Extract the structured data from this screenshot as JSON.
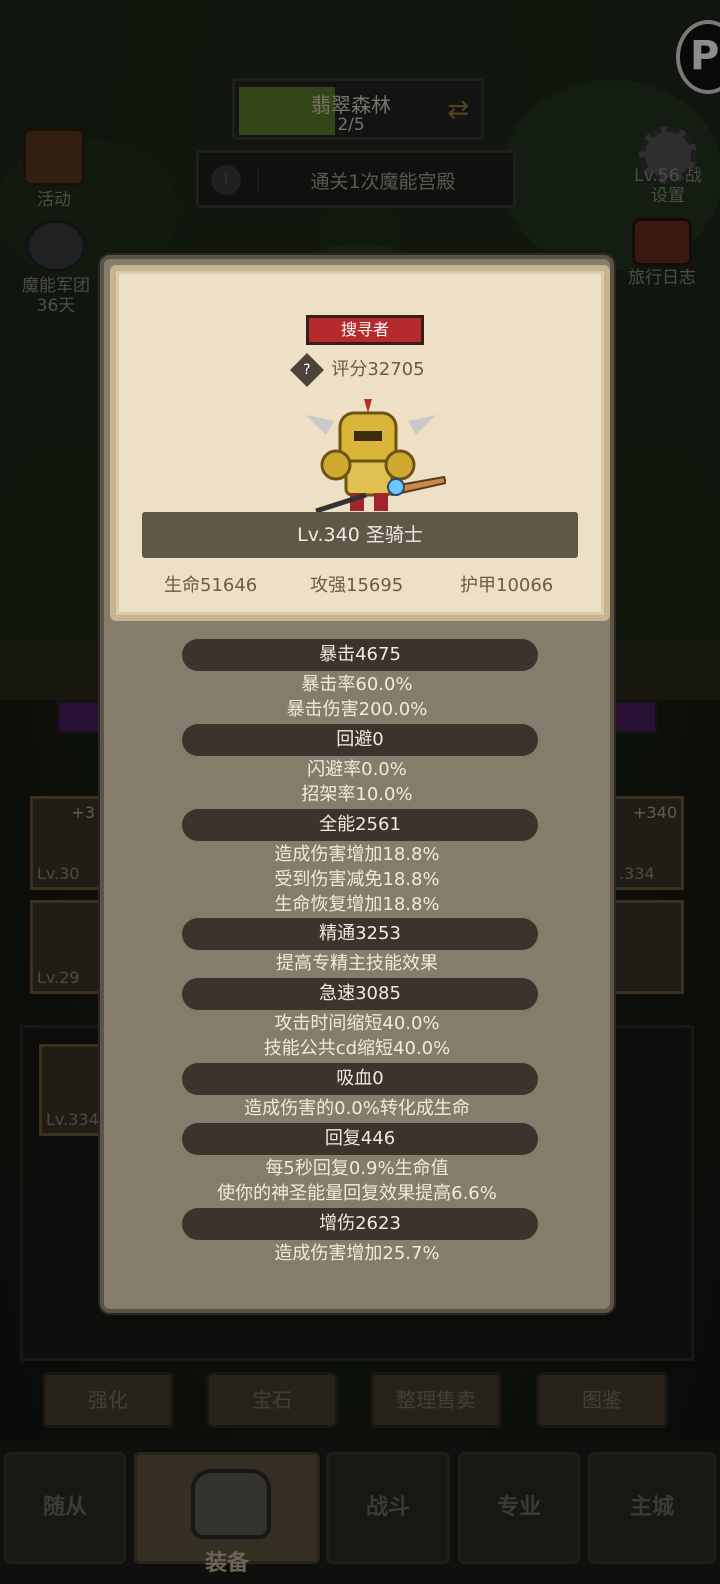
{
  "top": {
    "stage_name": "翡翠森林",
    "stage_progress": "2/5",
    "stage_progress_fraction": 0.4,
    "quest_text": "通关1次魔能宫殿"
  },
  "side_left": [
    {
      "label": "活动"
    },
    {
      "label": "魔能军团",
      "sub": "36天"
    }
  ],
  "side_right": [
    {
      "label": "Lv.56 战",
      "sub": "设置"
    },
    {
      "label": "旅行日志"
    }
  ],
  "slots": {
    "left_top_plus": "+3",
    "left_top_lv": "Lv.30",
    "left_bottom_lv": "Lv.29",
    "right_top_plus": "+340",
    "right_top_lv": ".334",
    "bag_lv": "Lv.334"
  },
  "bottom_buttons": [
    "强化",
    "宝石",
    "整理售卖",
    "图鉴"
  ],
  "nav": {
    "followers": "随从",
    "equipment": "装备",
    "battle": "战斗",
    "profession": "专业",
    "city": "主城"
  },
  "popup": {
    "badge": "搜寻者",
    "score_icon": "?",
    "score": "评分32705",
    "name_level": "Lv.340 圣骑士",
    "base_stats": {
      "hp": "生命51646",
      "atk": "攻强15695",
      "armor": "护甲10066"
    },
    "sections": [
      {
        "header": "暴击4675",
        "lines": [
          "暴击率60.0%",
          "暴击伤害200.0%"
        ]
      },
      {
        "header": "回避0",
        "lines": [
          "闪避率0.0%",
          "招架率10.0%"
        ]
      },
      {
        "header": "全能2561",
        "lines": [
          "造成伤害增加18.8%",
          "受到伤害减免18.8%",
          "生命恢复增加18.8%"
        ]
      },
      {
        "header": "精通3253",
        "lines": [
          "提高专精主技能效果"
        ]
      },
      {
        "header": "急速3085",
        "lines": [
          "攻击时间缩短40.0%",
          "技能公共cd缩短40.0%"
        ]
      },
      {
        "header": "吸血0",
        "lines": [
          "造成伤害的0.0%转化成生命"
        ]
      },
      {
        "header": "回复446",
        "lines": [
          "每5秒回复0.9%生命值",
          "使你的神圣能量回复效果提高6.6%"
        ]
      },
      {
        "header": "增伤2623",
        "lines": [
          "造成伤害增加25.7%"
        ]
      }
    ]
  },
  "colors": {
    "badge_red": "#b52a2a",
    "stage_progress_green": "#5f7f2a",
    "card_parchment": "#eee0c6",
    "stat_header_dark": "#3a342c"
  }
}
